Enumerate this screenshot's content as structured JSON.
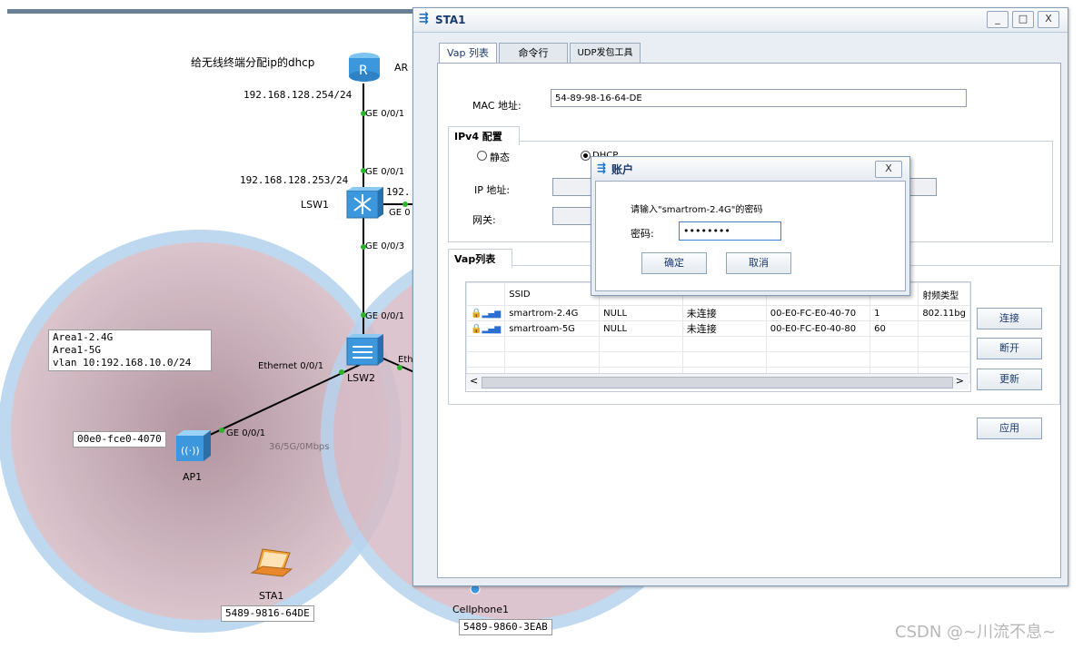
{
  "topology": {
    "dhcp_note": "给无线终端分配ip的dhcp",
    "ar_label": "AR",
    "ar_ip": "192.168.128.254/24",
    "ar_port": "GE 0/0/1",
    "lsw1_up_port": "GE 0/0/1",
    "lsw1_ip": "192.168.128.253/24",
    "lsw1_ip2": "192.",
    "lsw1_right_port": "GE 0",
    "lsw1_label": "LSW1",
    "lsw1_down_port": "GE 0/0/3",
    "lsw2_up_port": "GE 0/0/1",
    "lsw2_left_port": "Ethernet 0/0/1",
    "lsw2_right_port": "Eth",
    "lsw2_label": "LSW2",
    "area_note": "Area1-2.4G\nArea1-5G\nvlan 10:192.168.10.0/24",
    "ap1_mac": "00e0-fce0-4070",
    "ap1_port": "GE 0/0/1",
    "ap1_label": "AP1",
    "link_speed": "36/5G/0Mbps",
    "sta1_label": "STA1",
    "sta1_mac": "5489-9816-64DE",
    "cellphone_label": "Cellphone1",
    "cellphone_mac": "5489-9860-3EAB"
  },
  "window": {
    "title": "STA1",
    "minimize": "_",
    "maximize": "□",
    "close": "X",
    "tabs": [
      {
        "label": "Vap 列表",
        "active": true
      },
      {
        "label": "命令行",
        "active": false
      },
      {
        "label": "UDP发包工具",
        "active": false
      }
    ],
    "mac_label": "MAC 地址:",
    "mac_value": "54-89-98-16-64-DE",
    "ipv4_group": "IPv4 配置",
    "static_label": "静态",
    "dhcp_label": "DHCP",
    "ip_label": "IP 地址:",
    "gateway_label": "网关:",
    "vap_group": "Vap列表",
    "vap_columns": [
      "",
      "SSID",
      "",
      "",
      "",
      "",
      "射频类型"
    ],
    "vap_rows": [
      {
        "ssid": "smartrom-2.4G",
        "security": "NULL",
        "status": "未连接",
        "bssid": "00-E0-FC-E0-40-70",
        "channel": "1",
        "radio": "802.11bg"
      },
      {
        "ssid": "smartroam-5G",
        "security": "NULL",
        "status": "未连接",
        "bssid": "00-E0-FC-E0-40-80",
        "channel": "60",
        "radio": ""
      }
    ],
    "connect_button": "连接",
    "disconnect_button": "断开",
    "refresh_button": "更新",
    "apply_button": "应用"
  },
  "dialog": {
    "title": "账户",
    "close": "X",
    "prompt": "请输入\"smartrom-2.4G\"的密码",
    "password_label": "密码:",
    "password_value": "••••••••",
    "ok_button": "确定",
    "cancel_button": "取消"
  },
  "watermark": "CSDN @~川流不息~",
  "colors": {
    "coverage_fill": "#c9a9b4",
    "coverage_ring": "#a9cbea",
    "window_bg": "#e9eef5",
    "link": "#000000",
    "port_dot": "#2bb52b"
  }
}
